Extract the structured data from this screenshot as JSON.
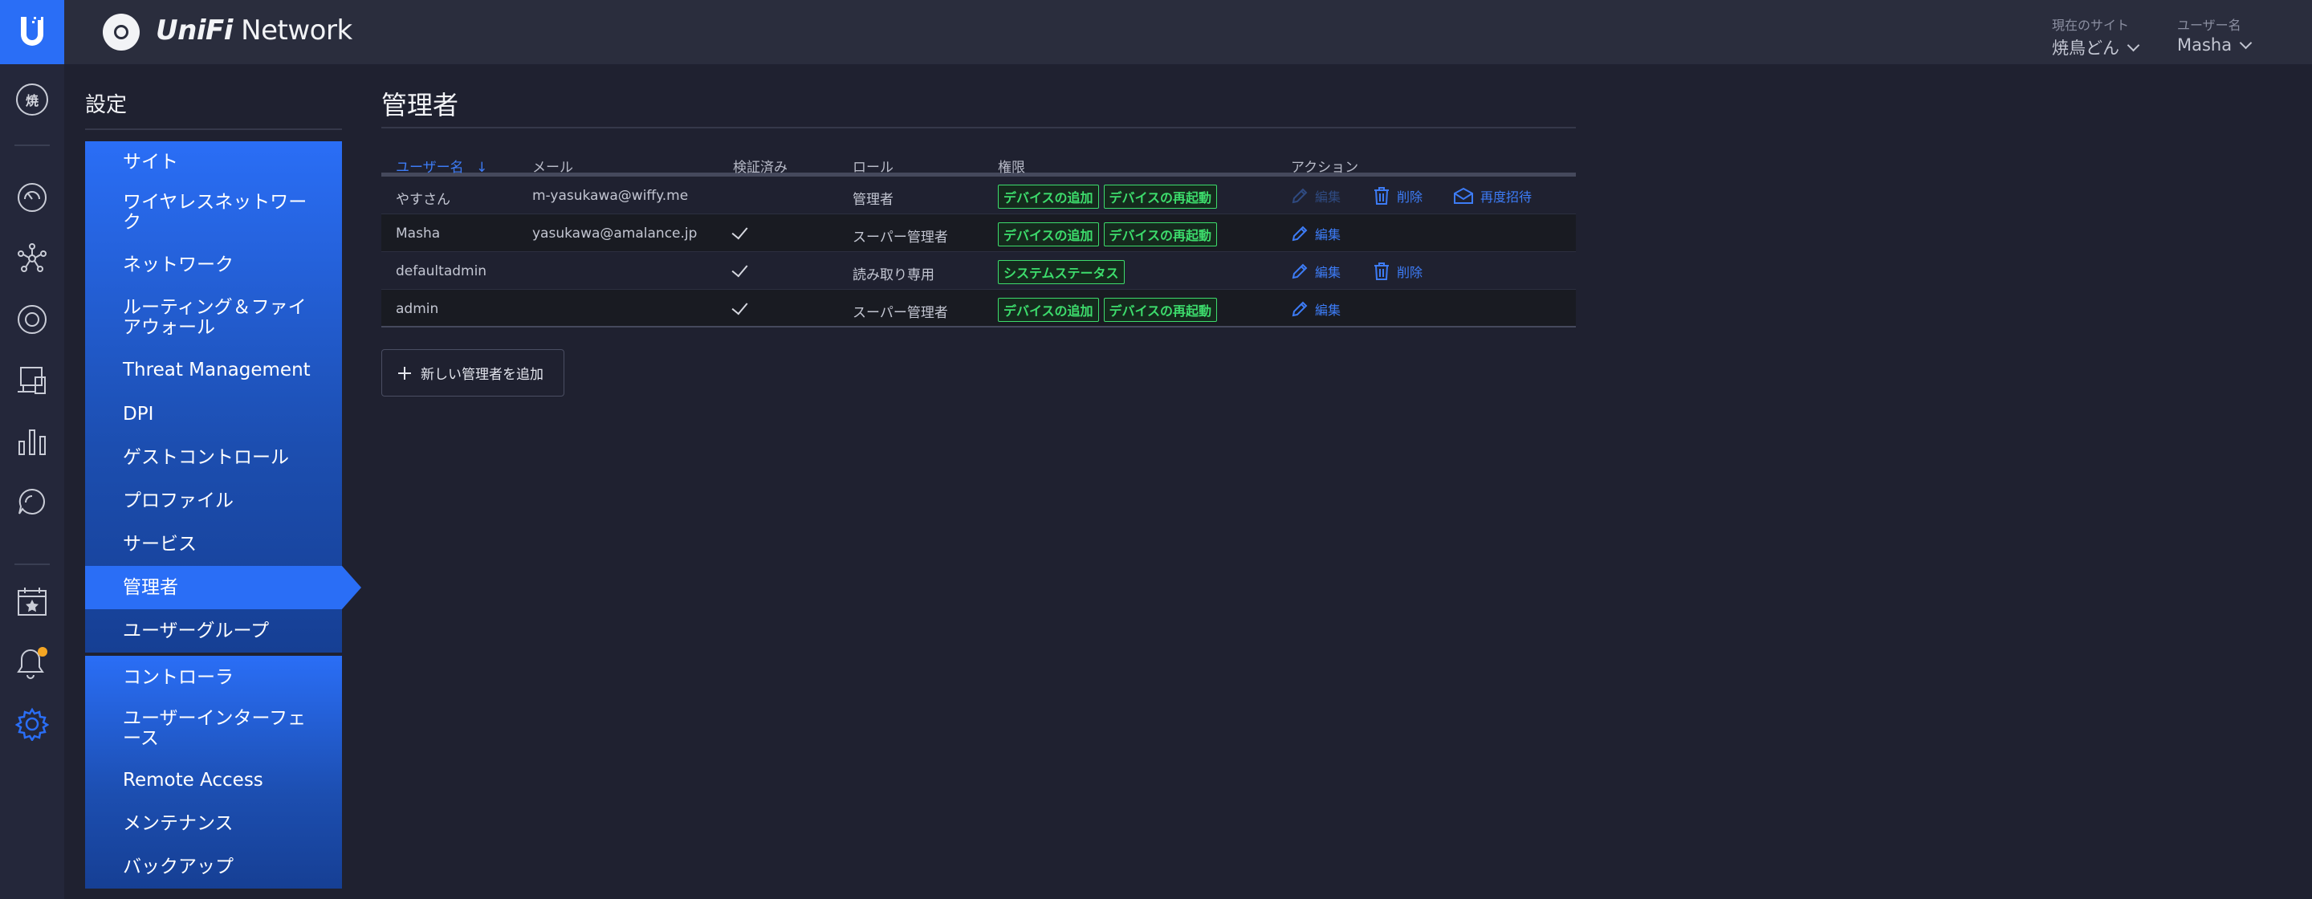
{
  "header": {
    "brand_unifi": "UniFi",
    "brand_network": "Network",
    "site_label": "現在のサイト",
    "site_value": "焼鳥どん",
    "user_label": "ユーザー名",
    "user_value": "Masha"
  },
  "rail": {
    "site_abbr": "焼",
    "icons": [
      "dashboard-icon",
      "topology-icon",
      "devices-icon",
      "clients-icon",
      "statistics-icon",
      "insights-icon",
      "events-icon",
      "alerts-icon",
      "settings-icon"
    ]
  },
  "settings": {
    "title": "設定",
    "group1": [
      "サイト",
      "ワイヤレスネットワーク",
      "ネットワーク",
      "ルーティング＆ファイアウォール",
      "Threat Management",
      "DPI",
      "ゲストコントロール",
      "プロファイル",
      "サービス",
      "管理者",
      "ユーザーグループ"
    ],
    "group2": [
      "コントローラ",
      "ユーザーインターフェース",
      "Remote Access",
      "メンテナンス",
      "バックアップ"
    ],
    "active": "管理者"
  },
  "page": {
    "title": "管理者",
    "columns": {
      "username": "ユーザー名",
      "sort_arrow": "↓",
      "email": "メール",
      "verified": "検証済み",
      "role": "ロール",
      "permissions": "権限",
      "actions": "アクション"
    },
    "rows": [
      {
        "username": "やすさん",
        "email": "m-yasukawa@wiffy.me",
        "verified": false,
        "role": "管理者",
        "permissions": [
          "デバイスの追加",
          "デバイスの再起動"
        ],
        "edit": "編集",
        "edit_disabled": true,
        "delete": "削除",
        "reinvite": "再度招待"
      },
      {
        "username": "Masha",
        "email": "yasukawa@amalance.jp",
        "verified": true,
        "role": "スーパー管理者",
        "permissions": [
          "デバイスの追加",
          "デバイスの再起動"
        ],
        "edit": "編集",
        "edit_disabled": false
      },
      {
        "username": "defaultadmin",
        "email": "",
        "verified": true,
        "role": "読み取り専用",
        "permissions": [
          "システムステータス"
        ],
        "edit": "編集",
        "edit_disabled": false,
        "delete": "削除"
      },
      {
        "username": "admin",
        "email": "",
        "verified": true,
        "role": "スーパー管理者",
        "permissions": [
          "デバイスの追加",
          "デバイスの再起動"
        ],
        "edit": "編集",
        "edit_disabled": false
      }
    ],
    "add_button": "新しい管理者を追加"
  },
  "colors": {
    "accent": "#2a6ef6",
    "link": "#3d7cf6",
    "badge_green": "#3ddc6c",
    "notification_dot": "#f5a623"
  }
}
